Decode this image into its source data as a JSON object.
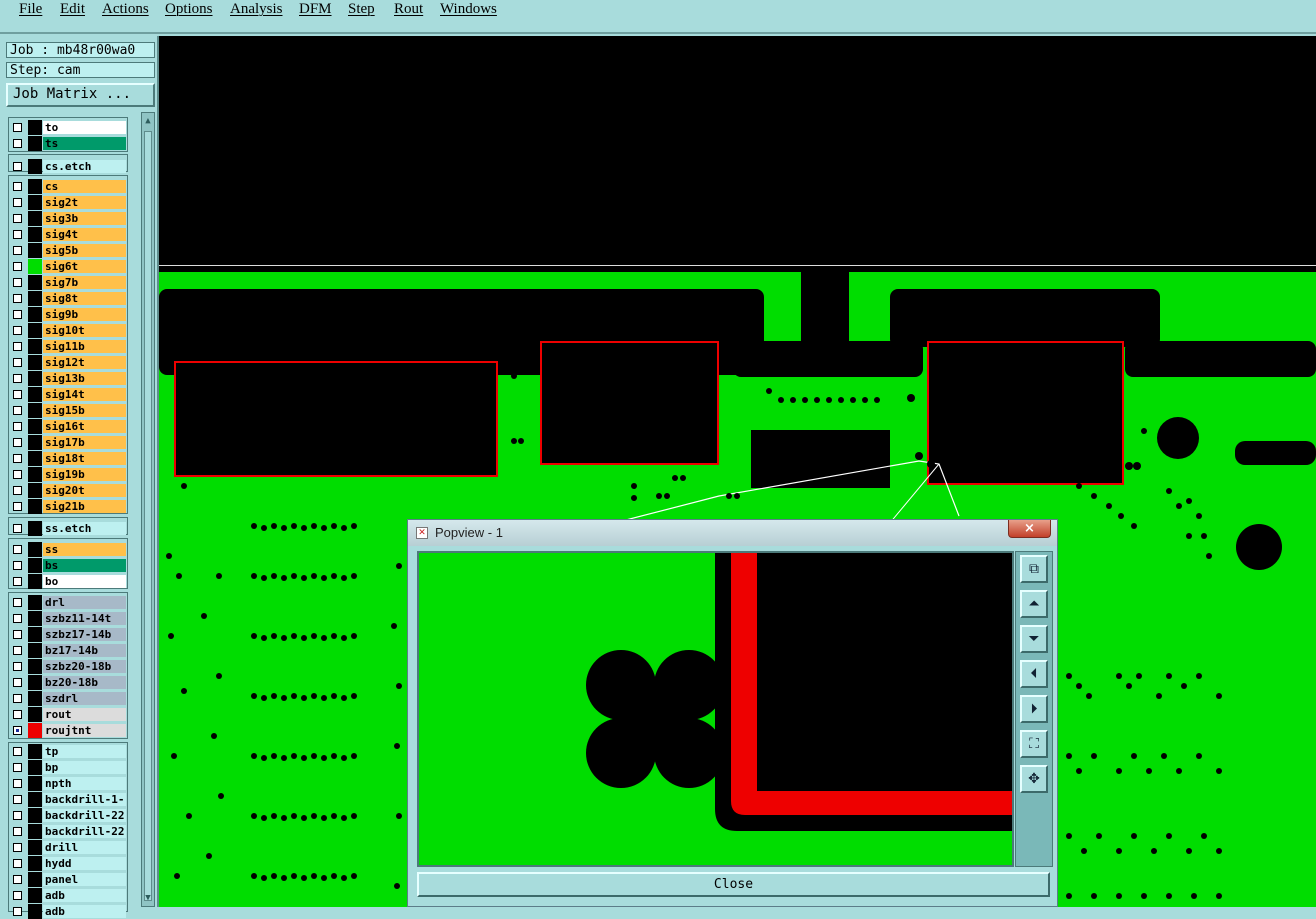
{
  "menu": [
    "File",
    "Edit",
    "Actions",
    "Options",
    "Analysis",
    "DFM",
    "Step",
    "Rout",
    "Windows"
  ],
  "job": {
    "job_line": "Job : mb48r00wa0",
    "step_line": "Step: cam",
    "matrix_button": "Job Matrix ..."
  },
  "layers": [
    {
      "name": "to",
      "color": "#ffffff"
    },
    {
      "name": "ts",
      "color": "#009a6a"
    },
    {
      "name": "cs.etch",
      "color": "#bdf0f0"
    },
    {
      "name": "cs",
      "color": "#ffc04a"
    },
    {
      "name": "sig2t",
      "color": "#ffc04a"
    },
    {
      "name": "sig3b",
      "color": "#ffc04a"
    },
    {
      "name": "sig4t",
      "color": "#ffc04a"
    },
    {
      "name": "sig5b",
      "color": "#ffc04a"
    },
    {
      "name": "sig6t",
      "color": "#ffc04a",
      "indicator": "#00dd00"
    },
    {
      "name": "sig7b",
      "color": "#ffc04a"
    },
    {
      "name": "sig8t",
      "color": "#ffc04a"
    },
    {
      "name": "sig9b",
      "color": "#ffc04a"
    },
    {
      "name": "sig10t",
      "color": "#ffc04a"
    },
    {
      "name": "sig11b",
      "color": "#ffc04a"
    },
    {
      "name": "sig12t",
      "color": "#ffc04a"
    },
    {
      "name": "sig13b",
      "color": "#ffc04a"
    },
    {
      "name": "sig14t",
      "color": "#ffc04a"
    },
    {
      "name": "sig15b",
      "color": "#ffc04a"
    },
    {
      "name": "sig16t",
      "color": "#ffc04a"
    },
    {
      "name": "sig17b",
      "color": "#ffc04a"
    },
    {
      "name": "sig18t",
      "color": "#ffc04a"
    },
    {
      "name": "sig19b",
      "color": "#ffc04a"
    },
    {
      "name": "sig20t",
      "color": "#ffc04a"
    },
    {
      "name": "sig21b",
      "color": "#ffc04a"
    },
    {
      "name": "ss.etch",
      "color": "#bdf0f0"
    },
    {
      "name": "ss",
      "color": "#ffc04a"
    },
    {
      "name": "bs",
      "color": "#009a6a"
    },
    {
      "name": "bo",
      "color": "#ffffff"
    },
    {
      "name": "drl",
      "color": "#a7b9c8"
    },
    {
      "name": "szbz11-14t",
      "color": "#a7b9c8"
    },
    {
      "name": "szbz17-14b",
      "color": "#a7b9c8"
    },
    {
      "name": "bz17-14b",
      "color": "#a7b9c8"
    },
    {
      "name": "szbz20-18b",
      "color": "#a7b9c8"
    },
    {
      "name": "bz20-18b",
      "color": "#a7b9c8"
    },
    {
      "name": "szdrl",
      "color": "#a7b9c8"
    },
    {
      "name": "rout",
      "color": "#dcdcdc"
    },
    {
      "name": "roujtnt",
      "color": "#dcdcdc",
      "indicator": "#ee0000",
      "checked": true
    },
    {
      "name": "tp",
      "color": "#bdf0f0"
    },
    {
      "name": "bp",
      "color": "#bdf0f0"
    },
    {
      "name": "npth",
      "color": "#bdf0f0"
    },
    {
      "name": "backdrill-1-",
      "color": "#bdf0f0"
    },
    {
      "name": "backdrill-22",
      "color": "#bdf0f0"
    },
    {
      "name": "backdrill-22",
      "color": "#bdf0f0"
    },
    {
      "name": "drill",
      "color": "#bdf0f0"
    },
    {
      "name": "hydd",
      "color": "#bdf0f0"
    },
    {
      "name": "panel",
      "color": "#bdf0f0"
    },
    {
      "name": "adb",
      "color": "#bdf0f0"
    },
    {
      "name": "adb",
      "color": "#bdf0f0"
    }
  ],
  "colors": {
    "copper": "#00dd00",
    "outline": "#ee0000",
    "background": "#000000"
  },
  "popview": {
    "title": "Popview - 1",
    "close_x": "×",
    "close_button": "Close",
    "tools": [
      "pan-icon",
      "up-icon",
      "down-icon",
      "left-icon",
      "right-icon",
      "zoom-fit-icon",
      "zoom-out-icon"
    ]
  }
}
